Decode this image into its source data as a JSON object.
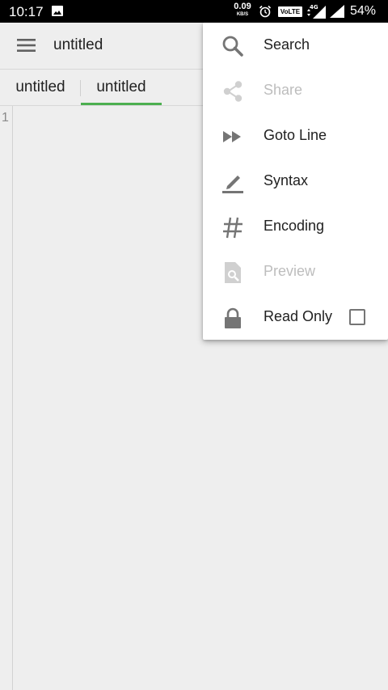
{
  "status_bar": {
    "time": "10:17",
    "speed_value": "0.09",
    "speed_unit": "KB/S",
    "volte": "VoLTE",
    "network": "4G",
    "battery": "54%"
  },
  "toolbar": {
    "title": "untitled",
    "menu_icon": "hamburger-menu-icon"
  },
  "tabs": [
    {
      "label": "untitled",
      "active": false
    },
    {
      "label": "untitled",
      "active": true
    }
  ],
  "editor": {
    "line_numbers": [
      "1"
    ],
    "content": ""
  },
  "overflow_menu": {
    "items": [
      {
        "label": "Search",
        "icon": "search-icon",
        "enabled": true
      },
      {
        "label": "Share",
        "icon": "share-icon",
        "enabled": false
      },
      {
        "label": "Goto Line",
        "icon": "fast-forward-icon",
        "enabled": true
      },
      {
        "label": "Syntax",
        "icon": "pen-icon",
        "enabled": true
      },
      {
        "label": "Encoding",
        "icon": "hash-icon",
        "enabled": true
      },
      {
        "label": "Preview",
        "icon": "file-preview-icon",
        "enabled": false
      },
      {
        "label": "Read Only",
        "icon": "lock-icon",
        "enabled": true,
        "checked": false
      }
    ]
  },
  "colors": {
    "accent": "#4caf50",
    "background": "#eeeeee",
    "menu_background": "#ffffff",
    "icon": "#757575",
    "disabled": "#bdbdbd"
  }
}
